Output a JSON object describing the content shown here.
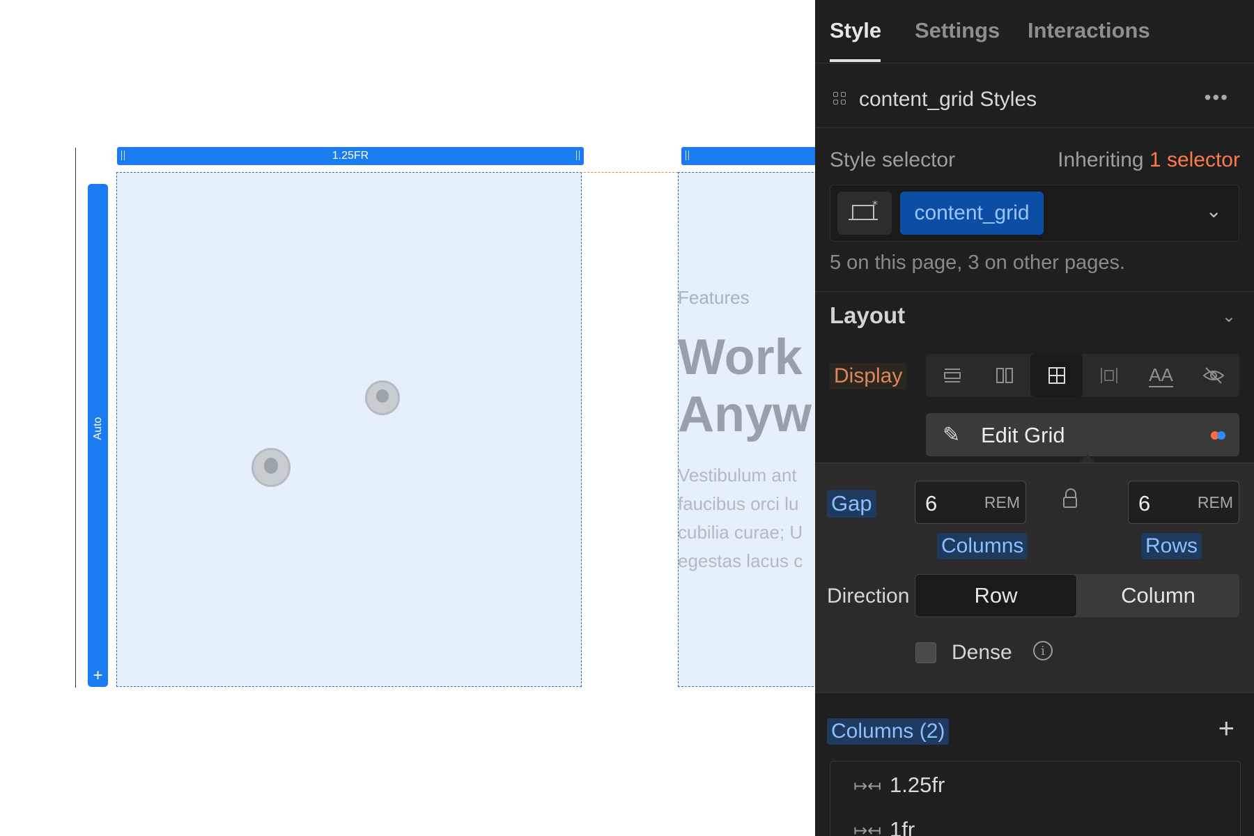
{
  "canvas": {
    "column_bar_label": "1.25FR",
    "row_bar_label": "Auto",
    "add_row_glyph": "+",
    "features": {
      "eyebrow": "Features",
      "heading_line1": "Work",
      "heading_line2": "Anyw",
      "body_lines": [
        "Vestibulum ant",
        "faucibus orci lu",
        "cubilia curae; U",
        "egestas lacus c"
      ]
    }
  },
  "panel": {
    "tabs": [
      {
        "label": "Style",
        "active": true
      },
      {
        "label": "Settings",
        "active": false
      },
      {
        "label": "Interactions",
        "active": false
      }
    ],
    "styles_title": "content_grid Styles",
    "more_glyph": "•••",
    "style_selector": {
      "label": "Style selector",
      "inheriting_prefix": "Inheriting",
      "inheriting_count": "1 selector",
      "selected_class": "content_grid",
      "usage_text": "5 on this page, 3 on other pages."
    },
    "layout": {
      "title": "Layout",
      "display_label": "Display",
      "display_options": [
        "block",
        "flex",
        "grid",
        "inline-block",
        "inline",
        "none"
      ],
      "display_active": "grid",
      "inline_text_glyph": "AA",
      "edit_grid_label": "Edit Grid",
      "status_dot_colors": [
        "#ff6a3d",
        "#2f8cff"
      ]
    },
    "grid": {
      "gap_label": "Gap",
      "columns_gap": {
        "value": "6",
        "unit": "REM",
        "label": "Columns"
      },
      "rows_gap": {
        "value": "6",
        "unit": "REM",
        "label": "Rows"
      },
      "direction_label": "Direction",
      "direction_options": [
        "Row",
        "Column"
      ],
      "direction_active": "Row",
      "dense_label": "Dense",
      "dense_checked": false,
      "info_glyph": "i"
    },
    "columns": {
      "header": "Columns (2)",
      "add_glyph": "+",
      "items": [
        "1.25fr",
        "1fr"
      ]
    }
  },
  "colors": {
    "accent_blue": "#1a7cf0",
    "panel_bg": "#1f1f1f",
    "highlight_orange": "#ff7a4a"
  }
}
